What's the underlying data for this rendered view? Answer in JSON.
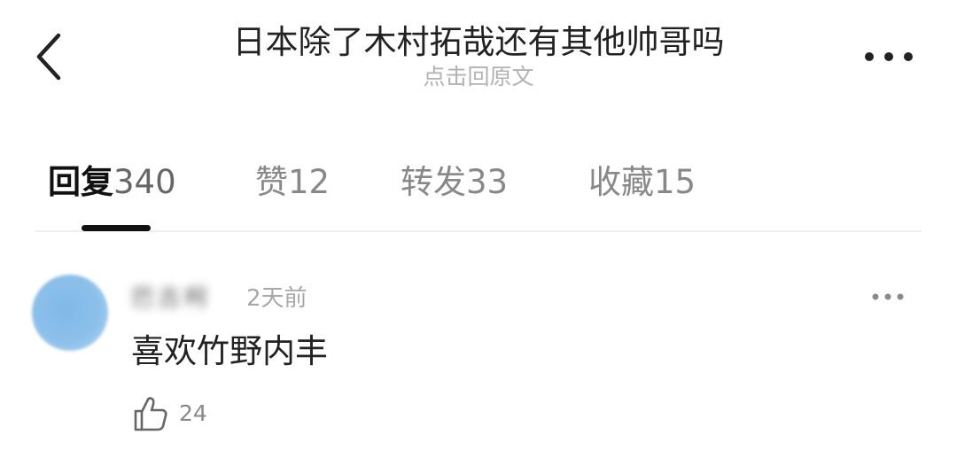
{
  "header": {
    "title": "日本除了木村拓哉还有其他帅哥吗",
    "subtitle": "点击回原文",
    "back_icon": "chevron-left-icon",
    "more_icon": "more-dots-icon"
  },
  "tabs": [
    {
      "label": "回复",
      "count": "340",
      "active": true
    },
    {
      "label": "赞",
      "count": "12",
      "active": false
    },
    {
      "label": "转发",
      "count": "33",
      "active": false
    },
    {
      "label": "收藏",
      "count": "15",
      "active": false
    }
  ],
  "comment": {
    "username": "巴古柯",
    "timestamp": "2天前",
    "text": "喜欢竹野内丰",
    "likes": "24",
    "like_icon": "thumbs-up-icon",
    "more_icon": "more-dots-icon",
    "avatar_color": "#8cc0ea"
  },
  "colors": {
    "primary_text": "#222222",
    "secondary_text": "#888888",
    "muted_text": "#b2b2b2",
    "indicator": "#111111"
  }
}
